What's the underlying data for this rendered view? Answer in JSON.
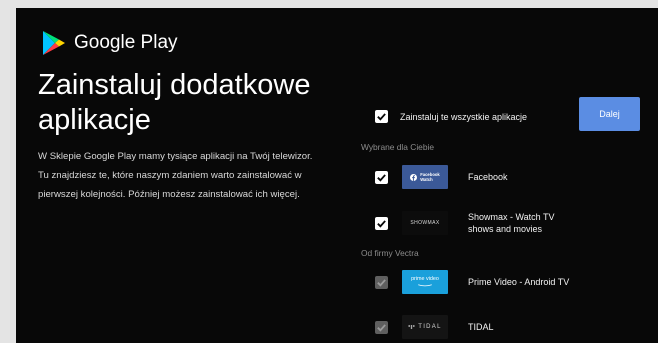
{
  "header": {
    "brand": "Google Play",
    "logo_icon": "google-play-icon"
  },
  "page": {
    "title_line1": "Zainstaluj dodatkowe",
    "title_line2": "aplikacje",
    "description": "W Sklepie Google Play mamy tysiące aplikacji na Twój telewizor. Tu znajdziesz te, które naszym zdaniem warto zainstalować w pierwszej kolejności. Później możesz zainstalować ich więcej."
  },
  "install_all": {
    "label": "Zainstaluj te wszystkie aplikacje",
    "checked": true
  },
  "next_button": {
    "label": "Dalej"
  },
  "sections": {
    "recommended": {
      "label": "Wybrane dla Ciebie",
      "apps": [
        {
          "name": "Facebook",
          "thumb_line1": "Facebook",
          "thumb_line2": "Watch",
          "checked": true
        },
        {
          "name": "Showmax - Watch TV shows and movies",
          "thumb_text": "SHOWMAX",
          "checked": true
        }
      ]
    },
    "vectra": {
      "label": "Od firmy Vectra",
      "apps": [
        {
          "name": "Prime Video - Android TV",
          "thumb_text": "prime video",
          "checked": true,
          "disabled": true
        },
        {
          "name": "TIDAL",
          "thumb_text": "TIDAL",
          "checked": true,
          "disabled": true
        }
      ]
    }
  },
  "colors": {
    "accent": "#5b8de3",
    "background": "#080808",
    "facebook": "#3b5998",
    "prime": "#1aa0db"
  }
}
